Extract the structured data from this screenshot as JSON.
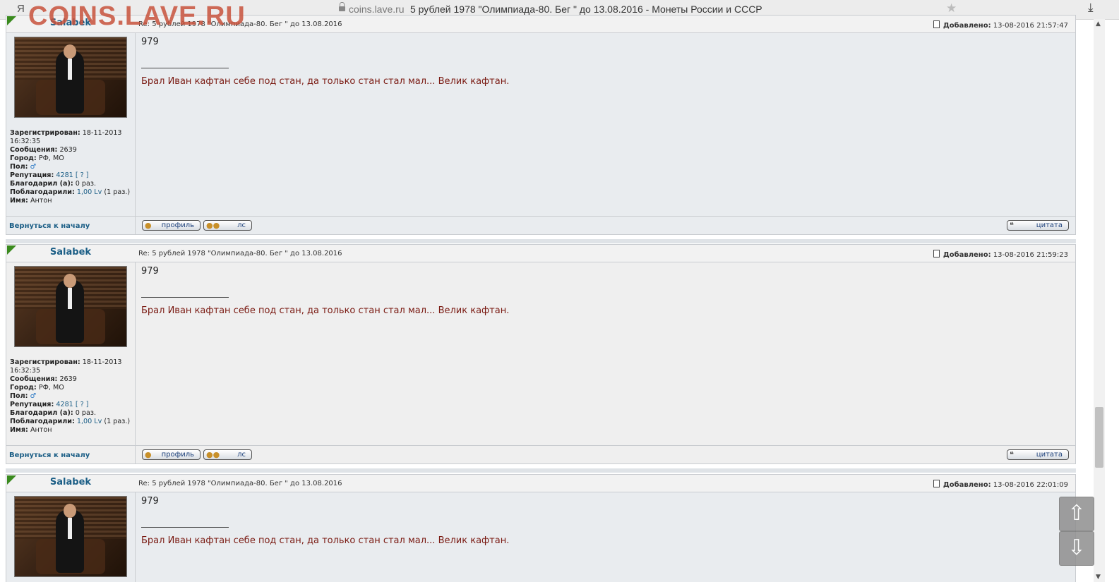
{
  "browser": {
    "left_glyph": "Я",
    "domain": "coins.lave.ru",
    "title": "5 рублей 1978 \"Олимпиада-80. Бег \" до 13.08.2016 - Монеты России и СССР",
    "watermark": "COINS.LAVE.RU"
  },
  "labels": {
    "added": "Добавлено:",
    "registered": "Зарегистрирован:",
    "messages": "Сообщения:",
    "city": "Город:",
    "gender": "Пол:",
    "reputation": "Репутация:",
    "thanked": "Благодарил (а):",
    "was_thanked": "Поблагодарили:",
    "name": "Имя:",
    "back_to_top": "Вернуться к началу",
    "profile_btn": "профиль",
    "pm_btn": "лс",
    "quote_btn": "цитата"
  },
  "user": {
    "author": "Salabek",
    "registered": "18-11-2013 16:32:35",
    "messages": "2639",
    "city": "РФ, МО",
    "gender_symbol": "♂",
    "reputation": "4281",
    "reputation_help": "[ ? ]",
    "thanked": "0 раз.",
    "was_thanked_value": "1,00 Lv",
    "was_thanked_count": "(1 раз.)",
    "name": "Антон",
    "signature": "Брал Иван кафтан себе под стан, да только стан стал мал... Велик кафтан."
  },
  "posts": [
    {
      "subject": "Re: 5 рублей 1978 \"Олимпиада-80. Бег \" до 13.08.2016",
      "added": "13-08-2016 21:57:47",
      "body": "979"
    },
    {
      "subject": "Re: 5 рублей 1978 \"Олимпиада-80. Бег \" до 13.08.2016",
      "added": "13-08-2016 21:59:23",
      "body": "979"
    },
    {
      "subject": "Re: 5 рублей 1978 \"Олимпиада-80. Бег \" до 13.08.2016",
      "added": "13-08-2016 22:01:09",
      "body": "979"
    }
  ],
  "nav": {
    "up": "⇧",
    "down": "⇩"
  }
}
